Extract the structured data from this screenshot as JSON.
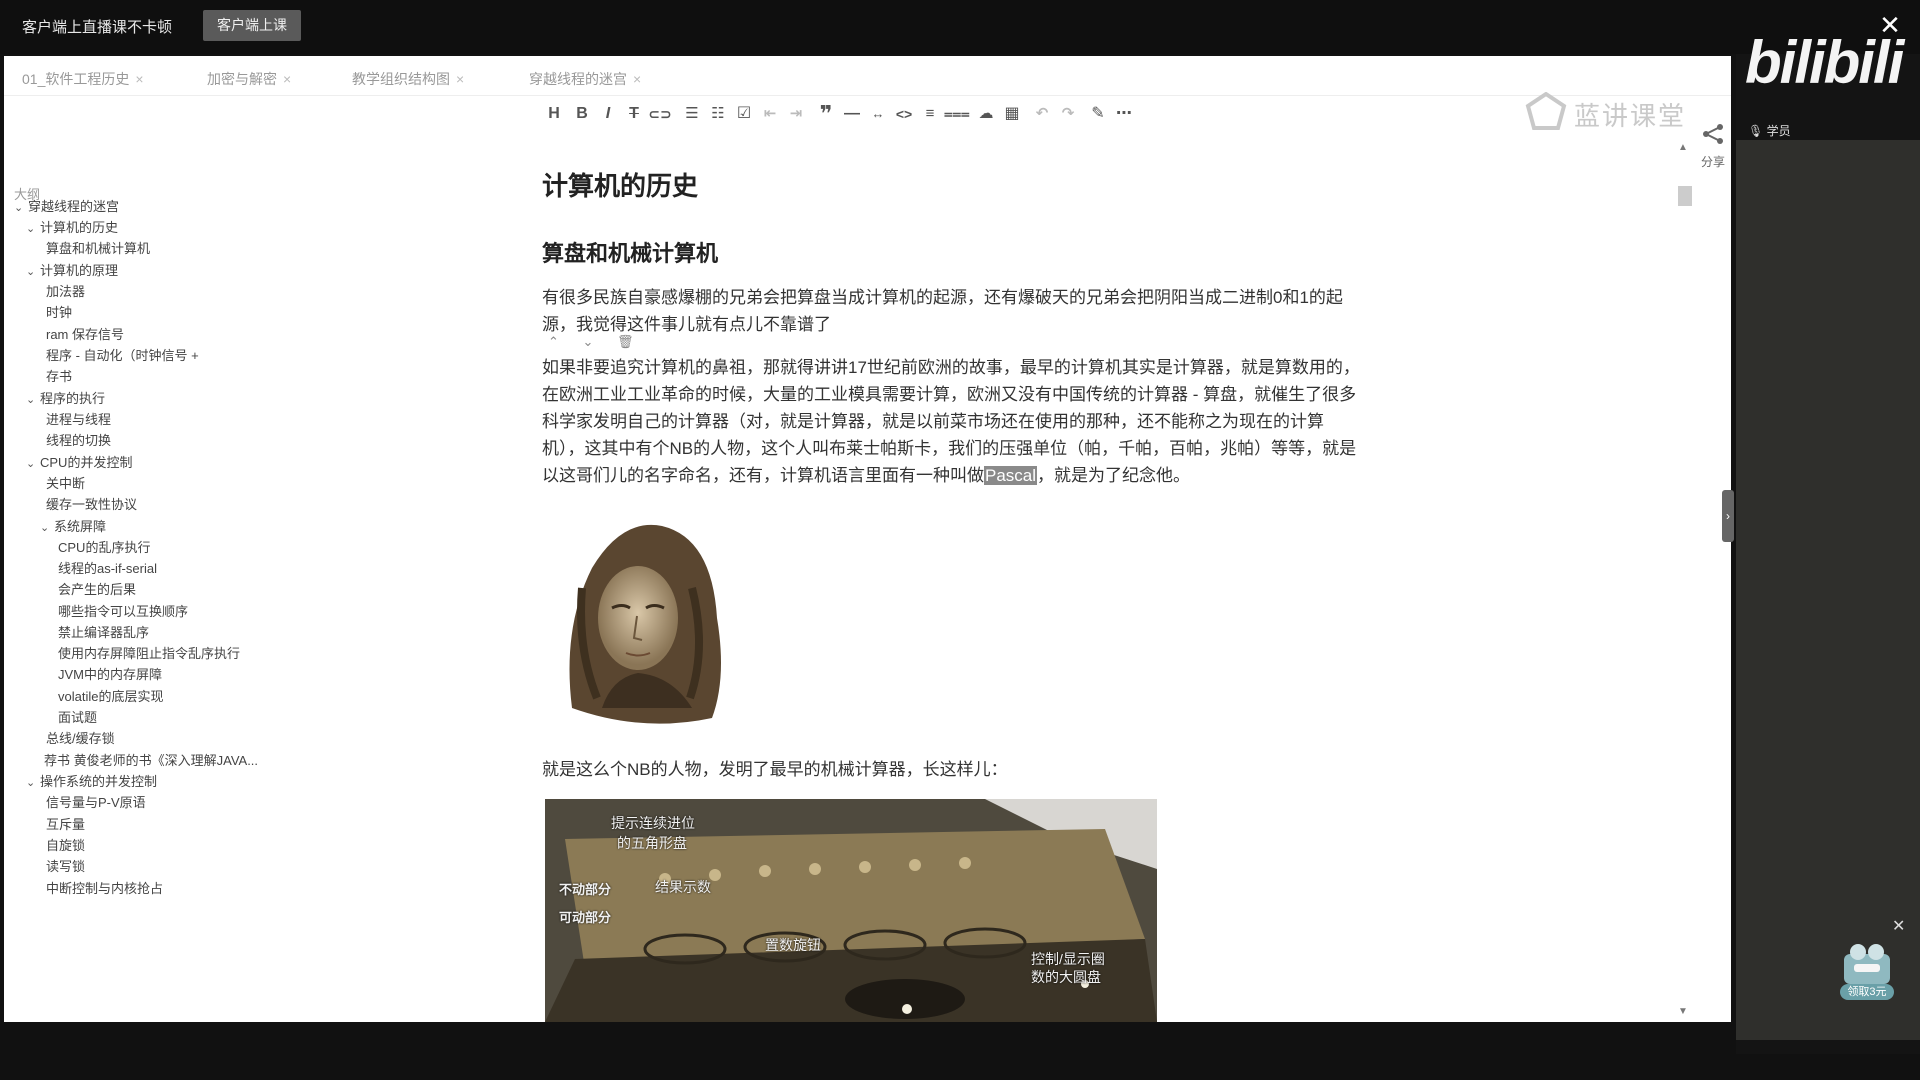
{
  "topbar": {
    "title": "客户端上直播课不卡顿",
    "live_button": "客户端上课",
    "close": "✕"
  },
  "tabs": [
    {
      "label": "01_软件工程历史"
    },
    {
      "label": "加密与解密"
    },
    {
      "label": "教学组织结构图"
    },
    {
      "label": "穿越线程的迷宫"
    }
  ],
  "tab_close": "×",
  "watermark": "蓝讲课堂",
  "share_label": "分享",
  "outline": {
    "title": "大纲",
    "items": [
      {
        "label": "穿越线程的迷宫",
        "expanded": true
      },
      {
        "label": "计算机的历史",
        "expanded": true
      },
      {
        "label": "算盘和机械计算机"
      },
      {
        "label": "计算机的原理",
        "expanded": true
      },
      {
        "label": "加法器"
      },
      {
        "label": "时钟"
      },
      {
        "label": "ram 保存信号"
      },
      {
        "label": "程序 - 自动化（时钟信号 +"
      },
      {
        "label": "存书"
      },
      {
        "label": "程序的执行",
        "expanded": true
      },
      {
        "label": "进程与线程"
      },
      {
        "label": "线程的切换"
      },
      {
        "label": "CPU的并发控制",
        "expanded": true
      },
      {
        "label": "关中断"
      },
      {
        "label": "缓存一致性协议"
      },
      {
        "label": "系统屏障",
        "expanded": true
      },
      {
        "label": "CPU的乱序执行"
      },
      {
        "label": "线程的as-if-serial"
      },
      {
        "label": "会产生的后果"
      },
      {
        "label": "哪些指令可以互换顺序"
      },
      {
        "label": "禁止编译器乱序"
      },
      {
        "label": "使用内存屏障阻止指令乱序执行"
      },
      {
        "label": "JVM中的内存屏障"
      },
      {
        "label": "volatile的底层实现"
      },
      {
        "label": "面试题"
      },
      {
        "label": "总线/缓存锁"
      },
      {
        "label": "荐书 黄俊老师的书《深入理解JAVA..."
      },
      {
        "label": "操作系统的并发控制",
        "expanded": true
      },
      {
        "label": "信号量与P-V原语"
      },
      {
        "label": "互斥量"
      },
      {
        "label": "自旋锁"
      },
      {
        "label": "读写锁"
      },
      {
        "label": "中断控制与内核抢占"
      }
    ]
  },
  "toolbar": {
    "icons": [
      "heading-icon",
      "bold-icon",
      "italic-icon",
      "strikethrough-icon",
      "link-icon",
      "bullet-list-icon",
      "ordered-list-icon",
      "checklist-icon",
      "outdent-icon",
      "indent-icon",
      "quote-icon",
      "hr-icon",
      "inline-code-icon",
      "code-block-icon",
      "align-icon",
      "format-icon",
      "upload-icon",
      "table-icon",
      "undo-icon",
      "redo-icon",
      "edit-icon",
      "more-icon"
    ]
  },
  "doc": {
    "h1": "计算机的历史",
    "h2": "算盘和机械计算机",
    "p1_line1": "有很多民族自豪感爆棚的兄弟会把算盘当成计算机的起源，还有爆破天的兄弟会把阴阳当成二进制0和1的起",
    "p1_line2": "源，我觉得这件事儿就有点儿不靠谱了",
    "block_tools": "⌃ ⌄ 🗑",
    "p2_line1": "如果非要追究计算机的鼻祖，那就得讲讲17世纪前欧洲的故事，最早的计算机其实是计算器，就是算数用的，",
    "p2_line2": "在欧洲工业工业革命的时候，大量的工业模具需要计算，欧洲又没有中国传统的计算器 - 算盘，就催生了很多",
    "p2_line3": "科学家发明自己的计算器（对，就是计算器，就是以前菜市场还在使用的那种，还不能称之为现在的计算",
    "p2_line4": "机），这其中有个NB的人物，这个人叫布莱士帕斯卡，我们的压强单位（帕，千帕，百帕，兆帕）等等，就是",
    "p2_line5a": "以这哥们儿的名字命名，还有，计算机语言里面有一种叫做",
    "p2_highlight": "Pascal",
    "p2_line5b": "，就是为了纪念他。",
    "p3": "就是这么个NB的人物，发明了最早的机械计算器，长这样儿：",
    "machine_labels": {
      "a": "提示连续进位",
      "b": "的五角形盘",
      "c": "不动部分",
      "d": "结果示数",
      "e": "可动部分",
      "f": "置数旋钮",
      "g": "控制/显示圈",
      "h": "数的大圆盘"
    }
  },
  "right": {
    "logo": "bilibili",
    "student": "学员",
    "coupon": "领取3元"
  },
  "colors": {
    "topbar_bg": "#0f0f0f",
    "page_bg": "#ffffff",
    "highlight": "#8a8a8a",
    "machine_tone": "#6d6350"
  }
}
